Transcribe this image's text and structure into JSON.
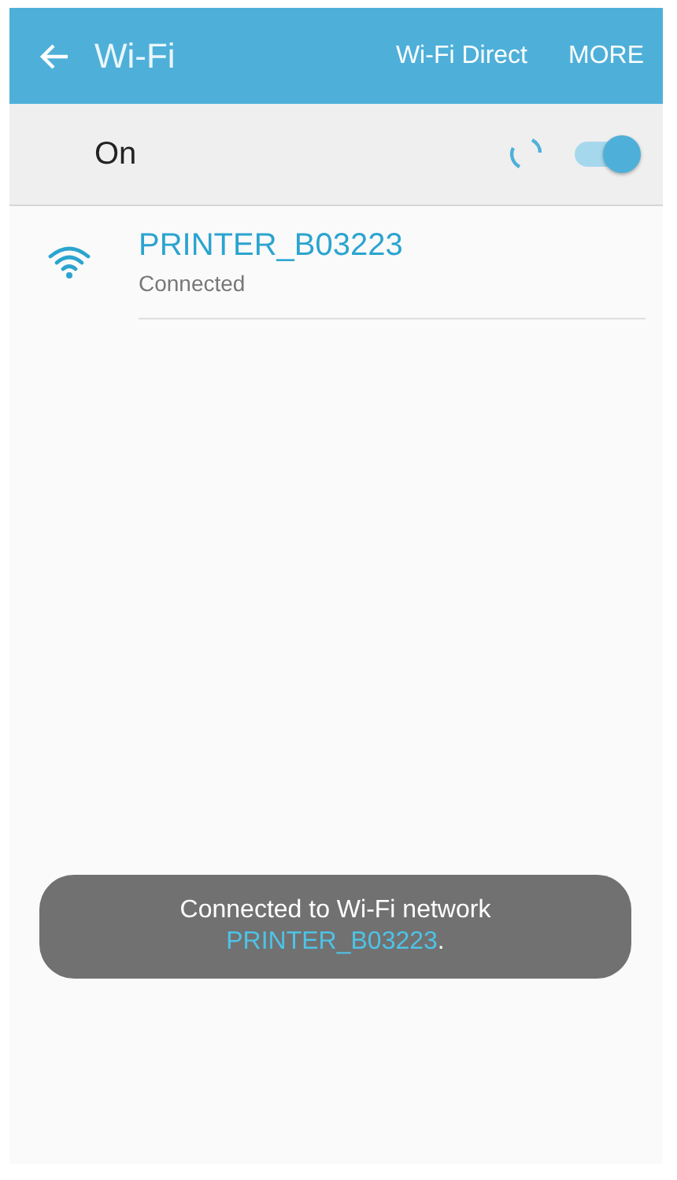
{
  "app_bar": {
    "title": "Wi-Fi",
    "actions": [
      "Wi-Fi Direct",
      "MORE"
    ]
  },
  "master_switch": {
    "label": "On",
    "on": true,
    "scanning": true
  },
  "networks": [
    {
      "name": "PRINTER_B03223",
      "status": "Connected",
      "connected": true
    }
  ],
  "toast": {
    "message": "Connected to Wi-Fi network",
    "network": "PRINTER_B03223",
    "suffix": "."
  }
}
